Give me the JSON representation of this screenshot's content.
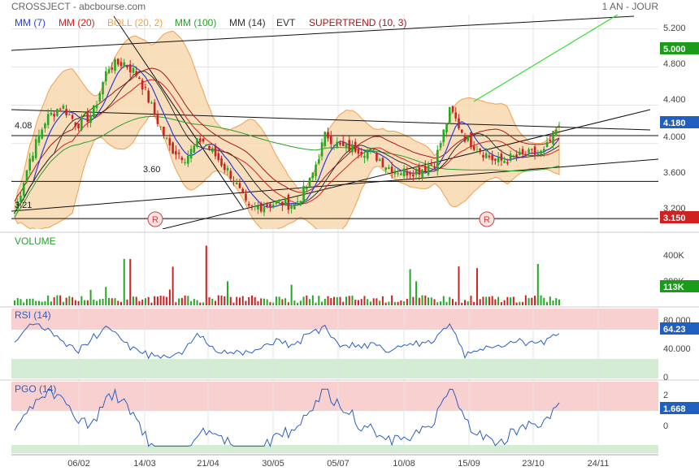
{
  "header": {
    "title": "CROSSJECT - abcbourse.com",
    "period": "1 AN - JOUR"
  },
  "legend": [
    {
      "label": "MM (7)",
      "color": "#2a3fd6"
    },
    {
      "label": "MM (20)",
      "color": "#d42020"
    },
    {
      "label": "BOLL (20, 2)",
      "color": "#f0a050"
    },
    {
      "label": "MM (100)",
      "color": "#2aa02a"
    },
    {
      "label": "MM (14)",
      "color": "#333333"
    },
    {
      "label": "EVT",
      "color": "#333333"
    },
    {
      "label": "SUPERTREND (10, 3)",
      "color": "#a01818"
    }
  ],
  "price_panel": {
    "ticks": [
      "5.200",
      "4.800",
      "4.400",
      "4.000",
      "3.600",
      "3.200"
    ],
    "last_badge": {
      "value": "4.180",
      "color": "#1f5fbf"
    },
    "badges": [
      {
        "value": "5.000",
        "color": "#1a9b1a"
      },
      {
        "value": "3.150",
        "color": "#d02020"
      }
    ],
    "level_labels": [
      "4.08",
      "3.60",
      "3.21"
    ],
    "markers": [
      "R",
      "R"
    ]
  },
  "volume_panel": {
    "title": "VOLUME",
    "ticks": [
      "400K",
      "200K"
    ],
    "last_badge": "113K"
  },
  "rsi_panel": {
    "title": "RSI (14)",
    "ticks": [
      "80.000",
      "40.000",
      "0"
    ],
    "last_badge": "64.23"
  },
  "pgo_panel": {
    "title": "PGO (14)",
    "ticks": [
      "2",
      "0"
    ],
    "last_badge": "1.668"
  },
  "x_ticks": [
    "06/02",
    "14/03",
    "21/04",
    "30/05",
    "05/07",
    "10/08",
    "15/09",
    "23/10",
    "24/11"
  ],
  "colors": {
    "up": "#22aa22",
    "down": "#cc2222",
    "boll_fill": "#f8d8b0",
    "boll_line": "#f0a050",
    "ovb_zone": "#f8d0d0",
    "ovs_zone": "#d4ecd4",
    "indicator": "#2a5fc0",
    "grid": "#e4e4e4"
  },
  "chart_data": {
    "type": "candlestick",
    "title": "CROSSJECT",
    "x_dates": [
      "06/02",
      "14/03",
      "21/04",
      "30/05",
      "05/07",
      "10/08",
      "15/09",
      "23/10",
      "24/11"
    ],
    "price_ylim": [
      3.1,
      5.35
    ],
    "price_path": [
      [
        "start",
        3.27
      ],
      [
        "",
        3.85
      ],
      [
        "",
        4.25
      ],
      [
        "",
        4.4
      ],
      [
        "06/02",
        4.2
      ],
      [
        "",
        4.3
      ],
      [
        "",
        4.8
      ],
      [
        "",
        4.85
      ],
      [
        "",
        4.7
      ],
      [
        "14/03",
        4.3
      ],
      [
        "",
        3.95
      ],
      [
        "",
        3.85
      ],
      [
        "",
        4.05
      ],
      [
        "",
        3.85
      ],
      [
        "21/04",
        3.65
      ],
      [
        "",
        3.3
      ],
      [
        "",
        3.35
      ],
      [
        "",
        3.38
      ],
      [
        "30/05",
        3.35
      ],
      [
        "",
        3.6
      ],
      [
        "",
        4.1
      ],
      [
        "",
        3.95
      ],
      [
        "05/07",
        3.95
      ],
      [
        "",
        3.9
      ],
      [
        "",
        3.75
      ],
      [
        "",
        3.7
      ],
      [
        "10/08",
        3.72
      ],
      [
        "",
        3.8
      ],
      [
        "",
        4.35
      ],
      [
        "",
        4.05
      ],
      [
        "15/09",
        3.92
      ],
      [
        "",
        3.8
      ],
      [
        "",
        3.85
      ],
      [
        "23/10",
        3.88
      ],
      [
        "",
        3.9
      ],
      [
        "last",
        4.18
      ]
    ],
    "horizontal_levels": [
      4.08,
      3.6,
      3.21
    ],
    "volume_ylim": [
      0,
      550000
    ],
    "rsi_ylim": [
      0,
      100
    ],
    "rsi_last": 64.23,
    "pgo_last": 1.668
  }
}
